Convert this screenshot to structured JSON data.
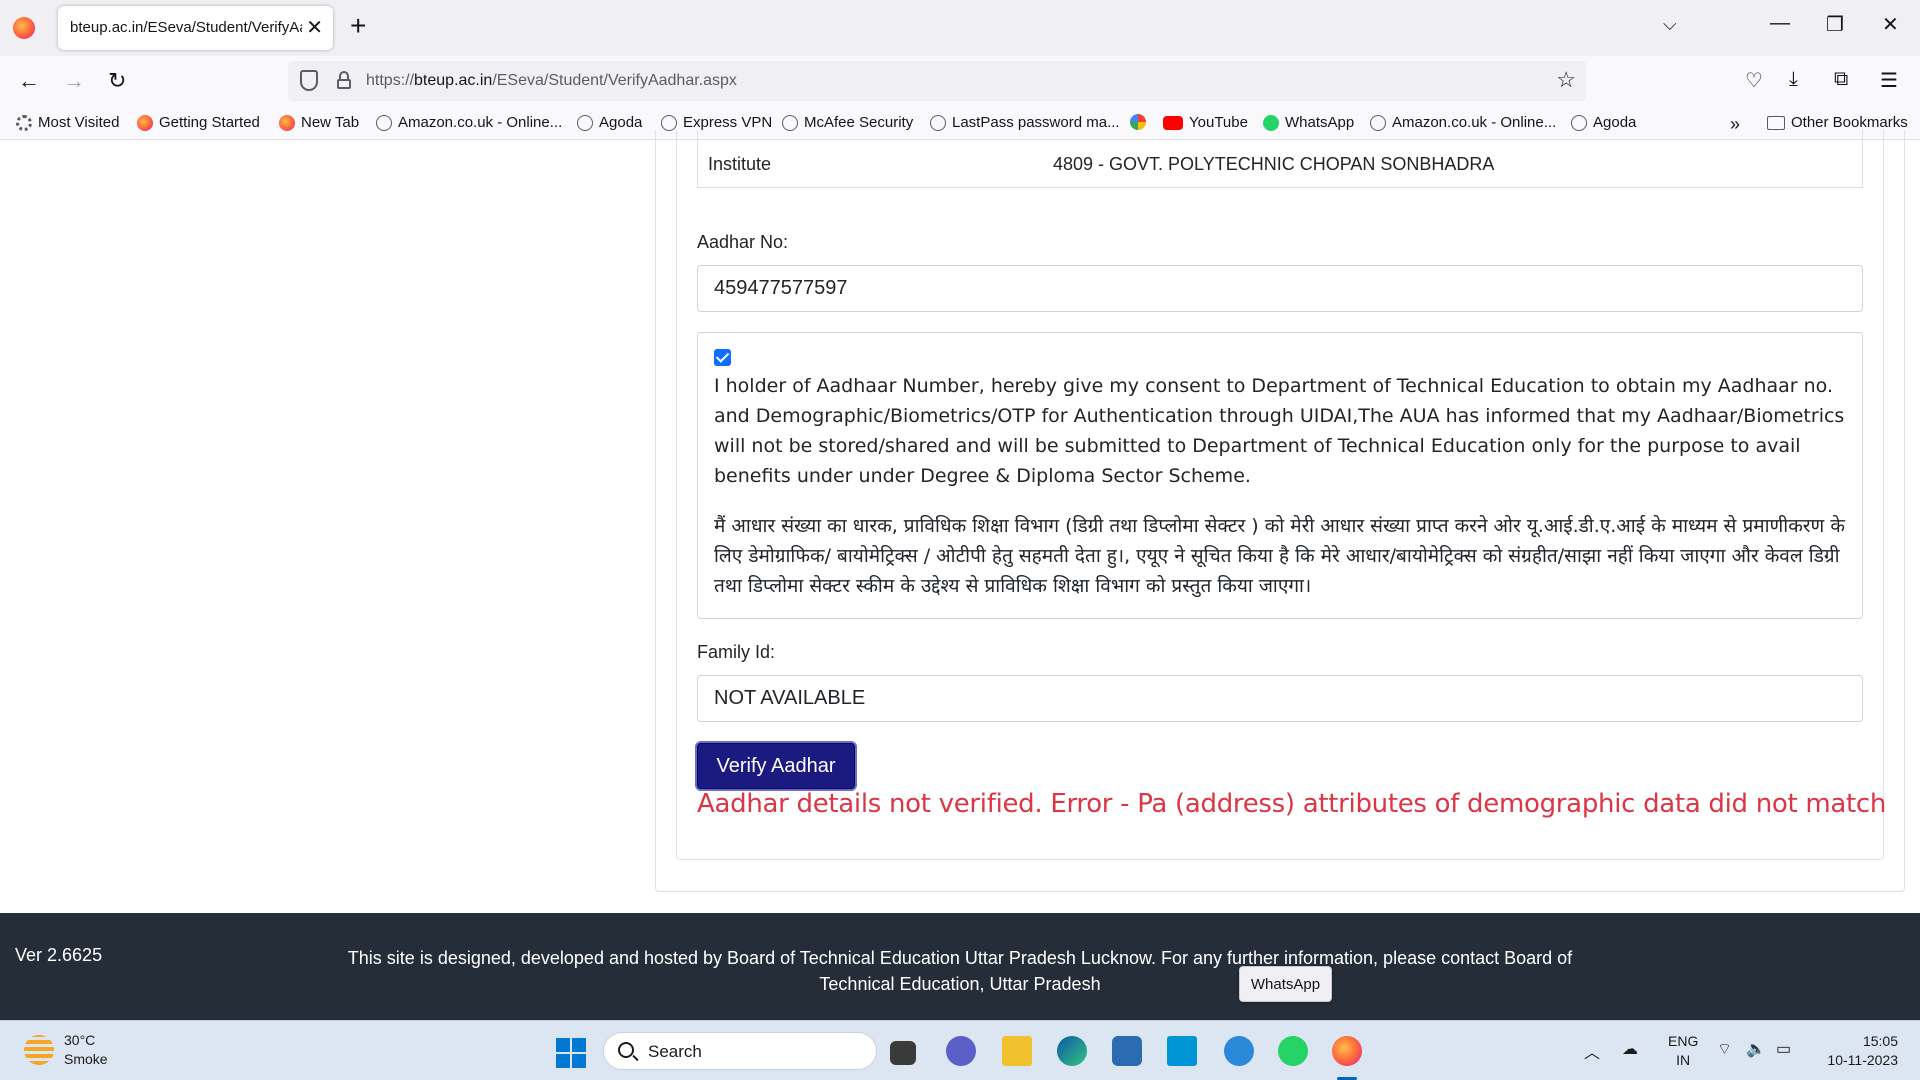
{
  "browser": {
    "tab_title": "bteup.ac.in/ESeva/Student/VerifyAa",
    "url_prefix": "https://",
    "url_host": "bteup.ac.in",
    "url_path": "/ESeva/Student/VerifyAadhar.aspx",
    "bookmarks": [
      {
        "label": "Most Visited",
        "icon": "gear-icon"
      },
      {
        "label": "Getting Started",
        "icon": "firefox-icon"
      },
      {
        "label": "New Tab",
        "icon": "firefox-icon"
      },
      {
        "label": "Amazon.co.uk - Online...",
        "icon": "globe-icon"
      },
      {
        "label": "Agoda",
        "icon": "globe-icon"
      },
      {
        "label": "Express VPN",
        "icon": "globe-icon"
      },
      {
        "label": "McAfee Security",
        "icon": "globe-icon"
      },
      {
        "label": "LastPass password ma...",
        "icon": "globe-icon"
      },
      {
        "label": "",
        "icon": "google-icon"
      },
      {
        "label": "YouTube",
        "icon": "youtube-icon"
      },
      {
        "label": "WhatsApp",
        "icon": "whatsapp-icon"
      },
      {
        "label": "Amazon.co.uk - Online...",
        "icon": "globe-icon"
      },
      {
        "label": "Agoda",
        "icon": "globe-icon"
      }
    ],
    "other_bookmarks": "Other Bookmarks"
  },
  "form": {
    "institute_label": "Institute",
    "institute_value": "4809 - GOVT. POLYTECHNIC CHOPAN SONBHADRA",
    "aadhar_label": "Aadhar No:",
    "aadhar_value": "459477577597",
    "consent_checked": true,
    "consent_en": "I holder of Aadhaar Number, hereby give my consent to Department of Technical Education to obtain my Aadhaar no. and Demographic/Biometrics/OTP for Authentication through UIDAI,The AUA has informed that my Aadhaar/Biometrics will not be stored/shared and will be submitted to Department of Technical Education only for the purpose to avail benefits under under Degree & Diploma Sector Scheme.",
    "consent_hi": "मैं आधार संख्या का धारक, प्राविधिक शिक्षा विभाग (डिग्री तथा डिप्लोमा सेक्टर ) को मेरी आधार संख्या प्राप्त करने ओर यू.आई.डी.ए.आई के माध्यम से प्रमाणीकरण के लिए डेमोग्राफिक/ बायोमेट्रिक्स / ओटीपी हेतु सहमती देता हु।, एयूए ने सूचित किया है कि मेरे आधार/बायोमेट्रिक्स को संग्रहीत/साझा नहीं किया जाएगा और केवल डिग्री तथा डिप्लोमा सेक्टर स्कीम के उद्देश्य से प्राविधिक शिक्षा विभाग को प्रस्तुत किया जाएगा।",
    "family_label": "Family Id:",
    "family_value": "NOT AVAILABLE",
    "verify_button": "Verify Aadhar",
    "error_message": "Aadhar details not verified. Error - Pa (address) attributes of demographic data did not match"
  },
  "footer": {
    "version": "Ver 2.6625",
    "text": "This site is designed, developed and hosted by Board of Technical Education Uttar Pradesh Lucknow. For any further information, please contact Board of Technical Education, Uttar Pradesh",
    "tooltip": "WhatsApp"
  },
  "taskbar": {
    "temperature": "30°C",
    "weather": "Smoke",
    "search_label": "Search",
    "lang_top": "ENG",
    "lang_bottom": "IN",
    "time": "15:05",
    "date": "10-11-2023"
  }
}
